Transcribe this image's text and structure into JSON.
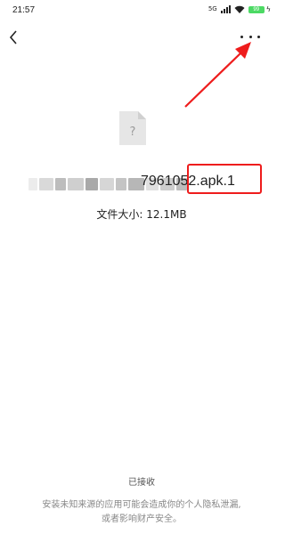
{
  "status_bar": {
    "time": "21:57",
    "network": "5G",
    "battery": "99"
  },
  "nav": {
    "back_icon": "chevron-left-icon",
    "more_icon": "more-horizontal-icon"
  },
  "file": {
    "icon": "unknown-file-icon",
    "name_visible": "7961052.apk.1",
    "size_label": "文件大小: 12.1MB"
  },
  "footer": {
    "status": "已接收",
    "warning_line1": "安装未知来源的应用可能会造成你的个人隐私泄漏,",
    "warning_line2": "或者影响财产安全。"
  },
  "colors": {
    "annotation": "#ee1c1c",
    "battery": "#4cd964"
  }
}
